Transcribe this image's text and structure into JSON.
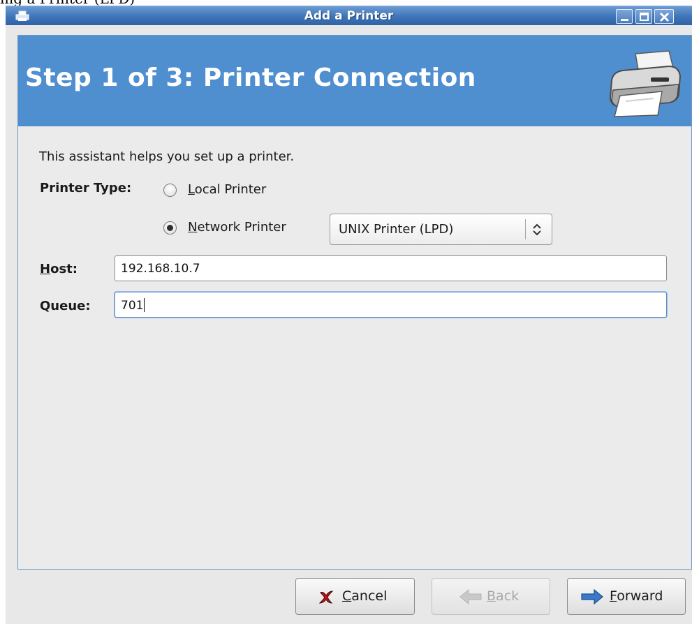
{
  "top_strip_text": "ing a Printer (LPD)",
  "window": {
    "title": "Add a Printer",
    "icon": "printer-icon",
    "controls": [
      "minimize-icon",
      "maximize-icon",
      "close-icon"
    ]
  },
  "banner": {
    "title": "Step 1 of 3: Printer Connection",
    "icon": "printer-illustration",
    "color": "#4f8fd0"
  },
  "intro_text": "This assistant helps you set up a printer.",
  "printer_type": {
    "label": "Printer Type:",
    "options": [
      {
        "label": "Local Printer",
        "mnemonic": "L",
        "rest": "ocal Printer",
        "selected": false
      },
      {
        "label": "Network Printer",
        "mnemonic": "N",
        "rest": "etwork Printer",
        "selected": true
      }
    ],
    "network_type": {
      "value": "UNIX Printer (LPD)"
    }
  },
  "host": {
    "label": "Host:",
    "mnemonic": "H",
    "rest": "ost:",
    "value": "192.168.10.7"
  },
  "queue": {
    "label": "Queue:",
    "value": "701"
  },
  "buttons": {
    "cancel": {
      "label": "Cancel",
      "mnemonic": "C",
      "rest": "ancel",
      "icon": "cancel-x-icon",
      "enabled": true
    },
    "back": {
      "label": "Back",
      "mnemonic": "B",
      "rest": "ack",
      "icon": "back-arrow-icon",
      "enabled": false
    },
    "forward": {
      "label": "Forward",
      "mnemonic": "F",
      "rest": "orward",
      "icon": "forward-arrow-icon",
      "enabled": true
    }
  }
}
